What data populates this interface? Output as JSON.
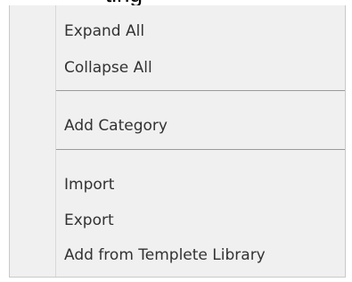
{
  "header": {
    "partial_text": "ting"
  },
  "context_menu": {
    "items": [
      {
        "label": "Expand All"
      },
      {
        "label": "Collapse All"
      },
      {
        "label": "Add Category"
      },
      {
        "label": "Import"
      },
      {
        "label": "Export"
      },
      {
        "label": "Add from Templete Library"
      }
    ]
  },
  "colors": {
    "menu_background": "#f0f0f0",
    "text": "#323232",
    "separator": "#9a9a9a",
    "border": "#c9c9c9"
  }
}
